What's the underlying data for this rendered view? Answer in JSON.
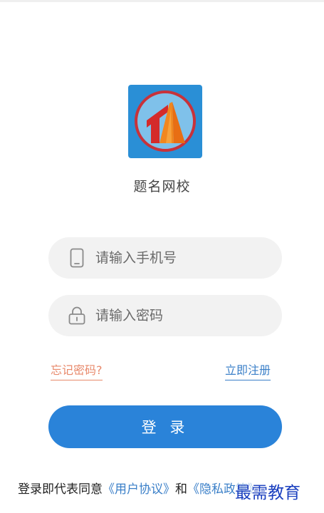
{
  "app": {
    "name": "题名网校"
  },
  "form": {
    "phone_placeholder": "请输入手机号",
    "password_placeholder": "请输入密码",
    "forgot_label": "忘记密码?",
    "register_label": "立即注册",
    "login_label": "登 录"
  },
  "agreement": {
    "prefix": "登录即代表同意",
    "user_agreement": "《用户协议》",
    "conjunction": "和",
    "privacy_policy": "《隐私政策》"
  },
  "watermark": {
    "text": "最需教育"
  },
  "icons": {
    "logo": "app-logo-icon",
    "phone": "phone-icon",
    "password": "lock-icon"
  },
  "colors": {
    "brand_blue": "#2a83d9",
    "forgot_link": "#e8896b",
    "register_link": "#3a7fc8",
    "field_bg": "#f2f2f2",
    "watermark": "#1a3fbf"
  }
}
